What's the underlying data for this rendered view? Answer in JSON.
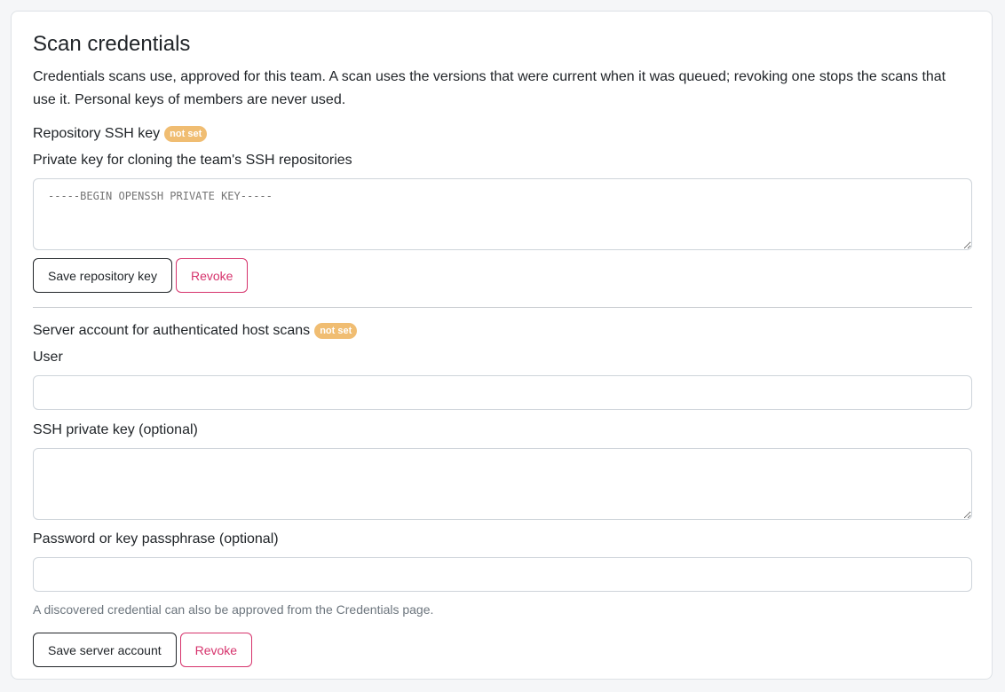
{
  "card": {
    "title": "Scan credentials",
    "description": "Credentials scans use, approved for this team. A scan uses the versions that were current when it was queued; revoking one stops the scans that use it. Personal keys of members are never used."
  },
  "repo_section": {
    "heading": "Repository SSH key",
    "badge": "not set",
    "field_label": "Private key for cloning the team's SSH repositories",
    "placeholder": "-----BEGIN OPENSSH PRIVATE KEY-----",
    "save_label": "Save repository key",
    "revoke_label": "Revoke"
  },
  "server_section": {
    "heading": "Server account for authenticated host scans",
    "badge": "not set",
    "user_label": "User",
    "user_value": "",
    "ssh_key_label": "SSH private key (optional)",
    "ssh_key_value": "",
    "password_label": "Password or key passphrase (optional)",
    "password_value": "",
    "hint": "A discovered credential can also be approved from the Credentials page.",
    "save_label": "Save server account",
    "revoke_label": "Revoke"
  },
  "colors": {
    "badge": "#f0bd72",
    "danger": "#d6336c",
    "dark": "#212529"
  }
}
